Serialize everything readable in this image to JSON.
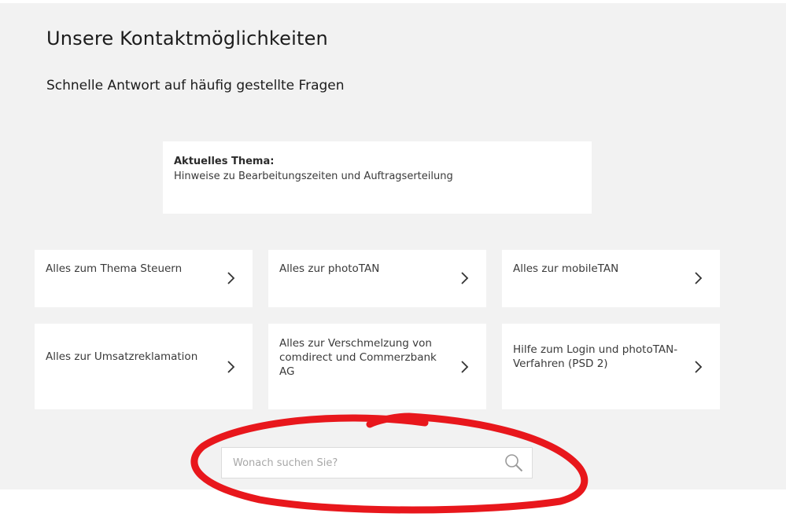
{
  "page": {
    "title": "Unsere Kontaktmöglichkeiten",
    "subtitle": "Schnelle Antwort auf häufig gestellte Fragen"
  },
  "notice": {
    "heading": "Aktuelles Thema:",
    "text": "Hinweise zu Bearbeitungszeiten und Auftragserteilung"
  },
  "tiles": [
    {
      "label": "Alles zum Thema Steuern"
    },
    {
      "label": "Alles zur photoTAN"
    },
    {
      "label": "Alles zur mobileTAN"
    },
    {
      "label": "Alles zur Umsatzreklamation"
    },
    {
      "label": "Alles zur Verschmelzung von comdirect und Commerzbank AG"
    },
    {
      "label": "Hilfe zum Login und photoTAN-Verfahren (PSD 2)"
    }
  ],
  "search": {
    "placeholder": "Wonach suchen Sie?",
    "value": ""
  },
  "colors": {
    "panel_background": "#f2f2f2",
    "tile_background": "#ffffff",
    "annotation_stroke": "#e8171c"
  },
  "icons": {
    "tile_arrow": "chevron-right-icon",
    "search": "search-icon"
  }
}
